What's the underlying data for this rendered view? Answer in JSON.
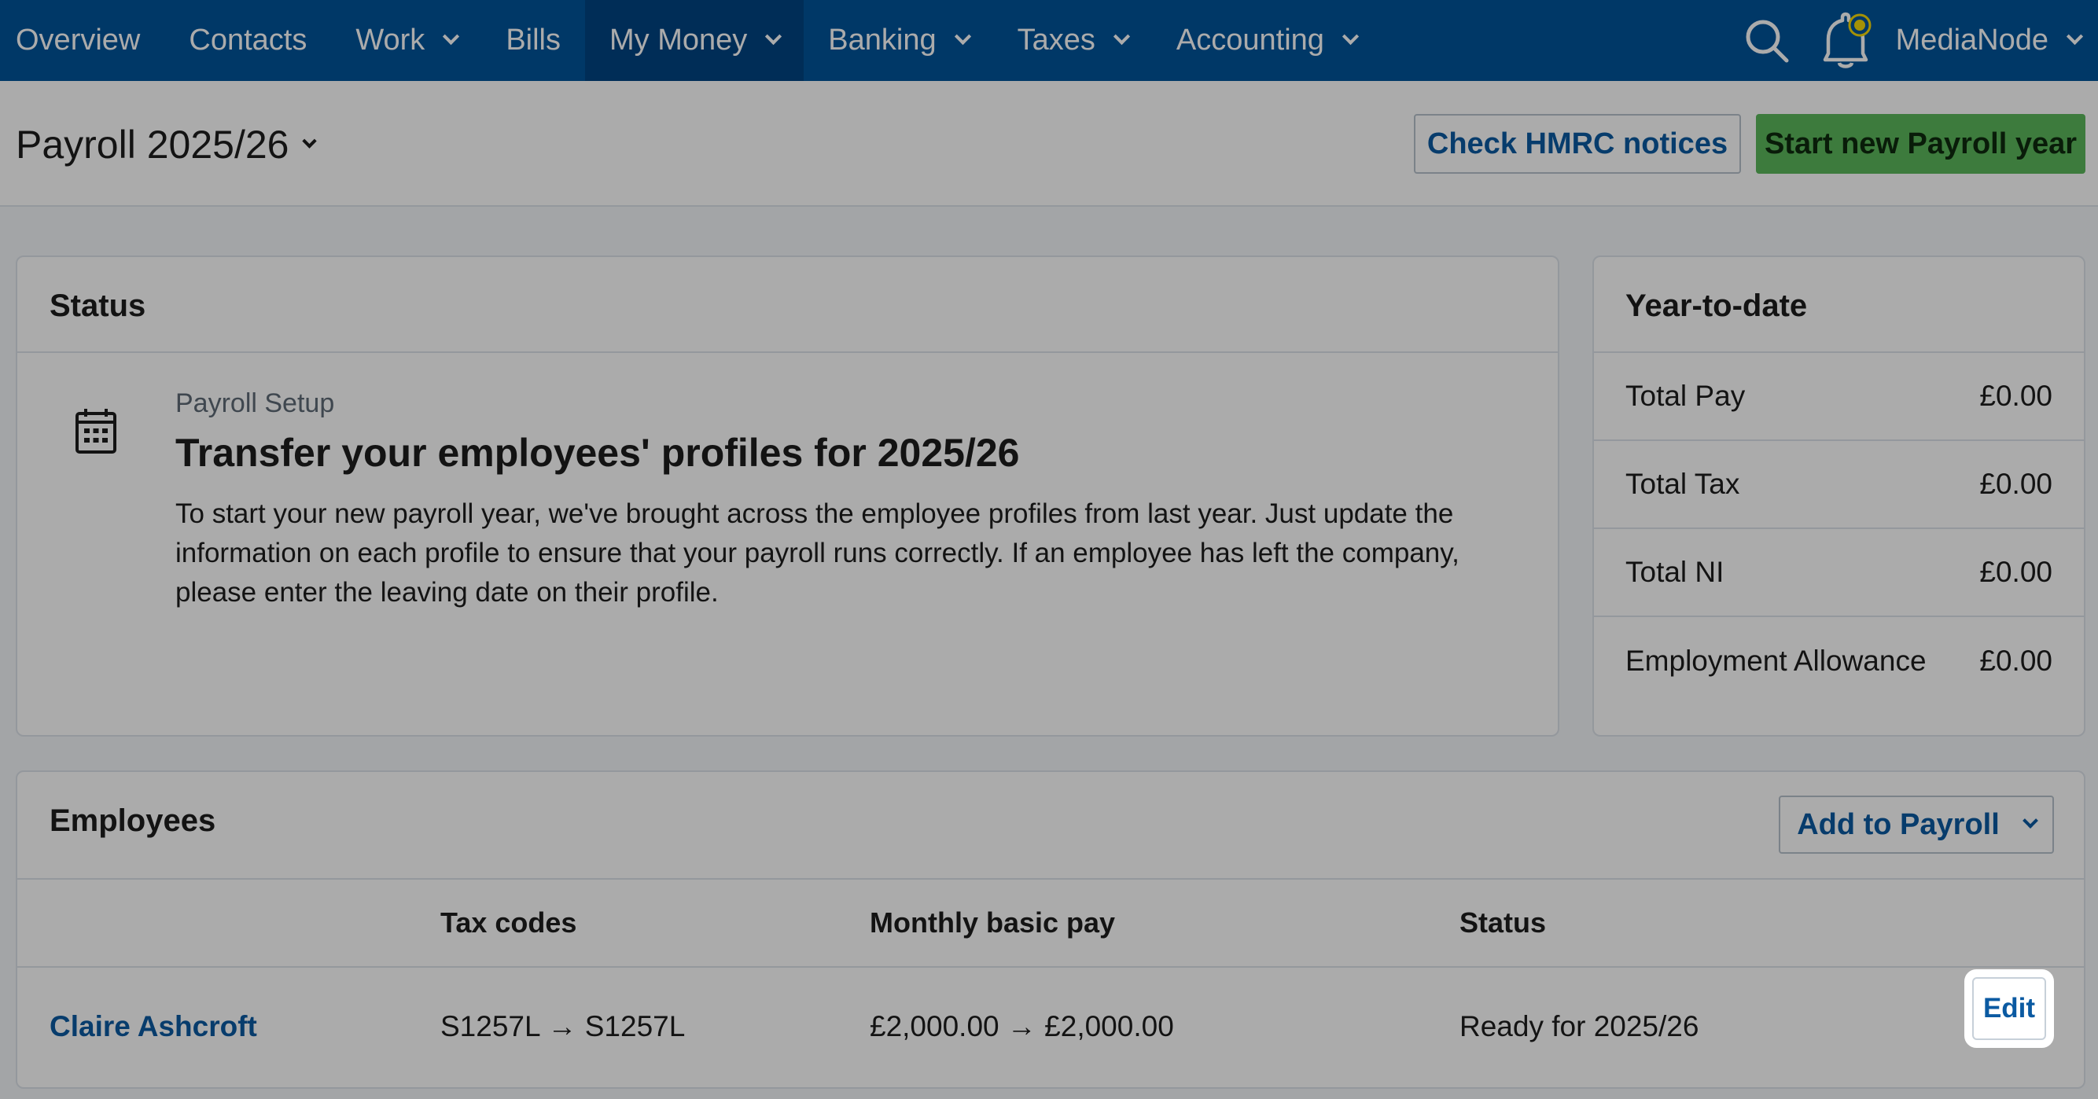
{
  "nav": {
    "items": [
      {
        "label": "Overview",
        "chevron": false,
        "active": false
      },
      {
        "label": "Contacts",
        "chevron": false,
        "active": false
      },
      {
        "label": "Work",
        "chevron": true,
        "active": false
      },
      {
        "label": "Bills",
        "chevron": false,
        "active": false
      },
      {
        "label": "My Money",
        "chevron": true,
        "active": true
      },
      {
        "label": "Banking",
        "chevron": true,
        "active": false
      },
      {
        "label": "Taxes",
        "chevron": true,
        "active": false
      },
      {
        "label": "Accounting",
        "chevron": true,
        "active": false
      }
    ],
    "search_icon": "search-icon",
    "notification_icon": "bell-icon",
    "account_label": "MediaNode"
  },
  "header": {
    "title": "Payroll 2025/26",
    "check_hmrc_label": "Check HMRC notices",
    "start_new_year_label": "Start new Payroll year"
  },
  "status": {
    "title": "Status",
    "icon": "calendar-icon",
    "setup_label": "Payroll Setup",
    "heading": "Transfer your employees' profiles for 2025/26",
    "body": "To start your new payroll year, we've brought across the employee profiles from last year. Just update the information on each profile to ensure that your payroll runs correctly. If an employee has left the company, please enter the leaving date on their profile."
  },
  "ytd": {
    "title": "Year-to-date",
    "rows": [
      {
        "label": "Total Pay",
        "value": "£0.00"
      },
      {
        "label": "Total Tax",
        "value": "£0.00"
      },
      {
        "label": "Total NI",
        "value": "£0.00"
      },
      {
        "label": "Employment Allowance",
        "value": "£0.00"
      }
    ]
  },
  "employees": {
    "title": "Employees",
    "add_label": "Add to Payroll",
    "columns": {
      "tax": "Tax codes",
      "pay": "Monthly basic pay",
      "status": "Status"
    },
    "rows": [
      {
        "name": "Claire Ashcroft",
        "tax": "S1257L → S1257L",
        "pay": "£2,000.00 → £2,000.00",
        "status": "Ready for 2025/26",
        "edit_label": "Edit"
      }
    ]
  },
  "colors": {
    "nav": "#00549a",
    "nav_active": "#004382",
    "green": "#5bb85b",
    "link": "#0b5aa2",
    "bell_badge": "#f5d90a"
  }
}
